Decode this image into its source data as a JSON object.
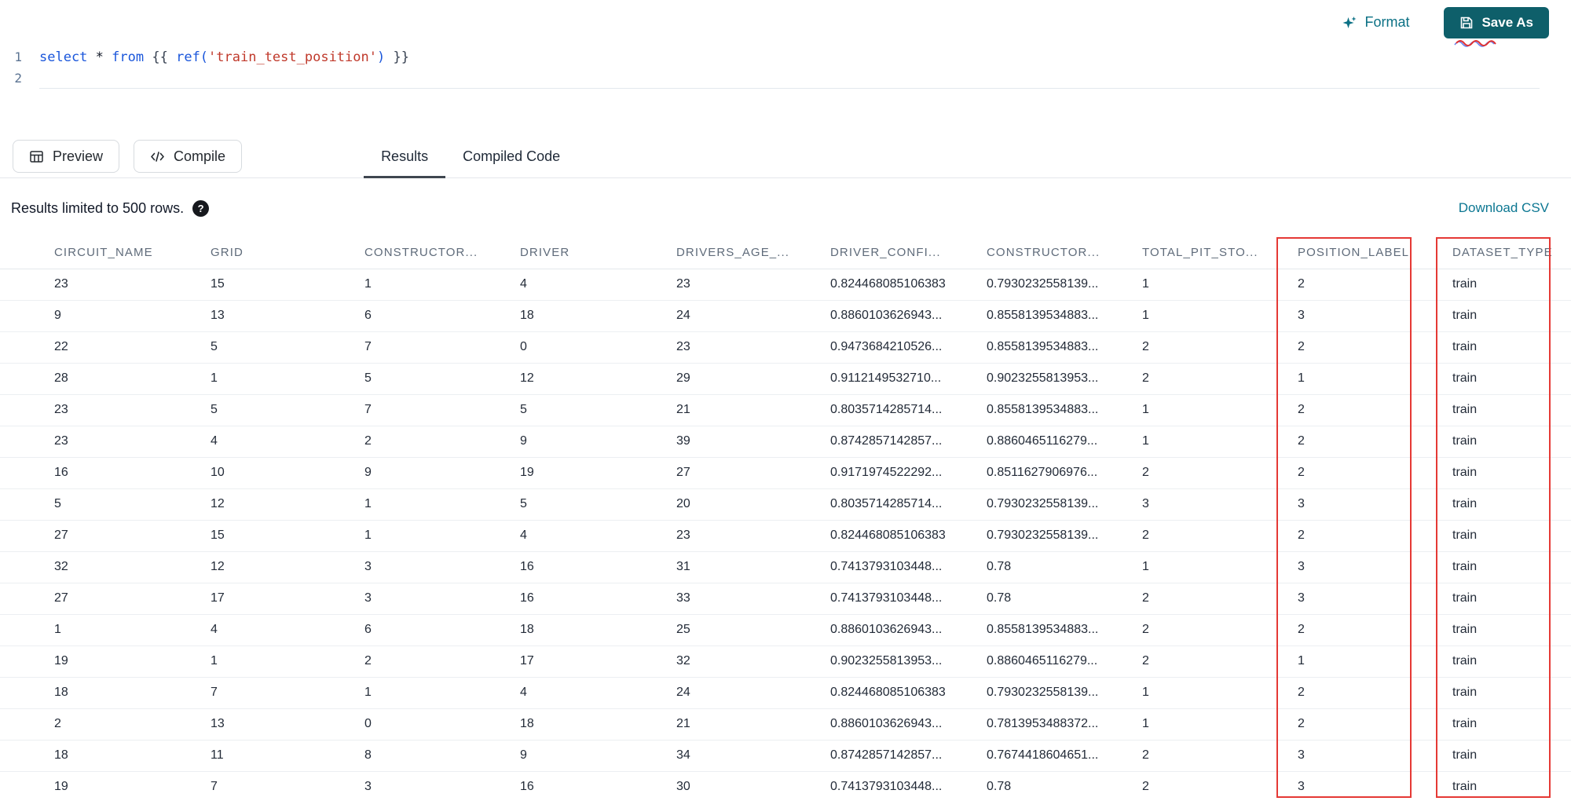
{
  "topbar": {
    "format_label": "Format",
    "save_as_label": "Save As"
  },
  "editor": {
    "line_numbers": [
      "1",
      "2"
    ],
    "code_tokens": [
      {
        "text": "select",
        "type": "kw"
      },
      {
        "text": " ",
        "type": "pl"
      },
      {
        "text": "*",
        "type": "op"
      },
      {
        "text": " ",
        "type": "pl"
      },
      {
        "text": "from",
        "type": "kw"
      },
      {
        "text": " ",
        "type": "pl"
      },
      {
        "text": "{{ ",
        "type": "jinja"
      },
      {
        "text": "ref(",
        "type": "fn"
      },
      {
        "text": "'train_test_position'",
        "type": "str"
      },
      {
        "text": ")",
        "type": "fn"
      },
      {
        "text": " }}",
        "type": "jinja"
      }
    ]
  },
  "toolbar": {
    "preview_label": "Preview",
    "compile_label": "Compile",
    "tabs": [
      {
        "label": "Results",
        "active": true
      },
      {
        "label": "Compiled Code",
        "active": false
      }
    ]
  },
  "results": {
    "limit_text": "Results limited to 500 rows.",
    "help_icon": "?",
    "download_label": "Download CSV"
  },
  "table": {
    "columns": [
      "CIRCUIT_NAME",
      "GRID",
      "CONSTRUCTOR...",
      "DRIVER",
      "DRIVERS_AGE_...",
      "DRIVER_CONFI...",
      "CONSTRUCTOR...",
      "TOTAL_PIT_STO...",
      "POSITION_LABEL",
      "DATASET_TYPE"
    ],
    "rows": [
      [
        "23",
        "15",
        "1",
        "4",
        "23",
        "0.824468085106383",
        "0.7930232558139...",
        "1",
        "2",
        "train"
      ],
      [
        "9",
        "13",
        "6",
        "18",
        "24",
        "0.8860103626943...",
        "0.8558139534883...",
        "1",
        "3",
        "train"
      ],
      [
        "22",
        "5",
        "7",
        "0",
        "23",
        "0.9473684210526...",
        "0.8558139534883...",
        "2",
        "2",
        "train"
      ],
      [
        "28",
        "1",
        "5",
        "12",
        "29",
        "0.9112149532710...",
        "0.9023255813953...",
        "2",
        "1",
        "train"
      ],
      [
        "23",
        "5",
        "7",
        "5",
        "21",
        "0.8035714285714...",
        "0.8558139534883...",
        "1",
        "2",
        "train"
      ],
      [
        "23",
        "4",
        "2",
        "9",
        "39",
        "0.8742857142857...",
        "0.8860465116279...",
        "1",
        "2",
        "train"
      ],
      [
        "16",
        "10",
        "9",
        "19",
        "27",
        "0.9171974522292...",
        "0.8511627906976...",
        "2",
        "2",
        "train"
      ],
      [
        "5",
        "12",
        "1",
        "5",
        "20",
        "0.8035714285714...",
        "0.7930232558139...",
        "3",
        "3",
        "train"
      ],
      [
        "27",
        "15",
        "1",
        "4",
        "23",
        "0.824468085106383",
        "0.7930232558139...",
        "2",
        "2",
        "train"
      ],
      [
        "32",
        "12",
        "3",
        "16",
        "31",
        "0.7413793103448...",
        "0.78",
        "1",
        "3",
        "train"
      ],
      [
        "27",
        "17",
        "3",
        "16",
        "33",
        "0.7413793103448...",
        "0.78",
        "2",
        "3",
        "train"
      ],
      [
        "1",
        "4",
        "6",
        "18",
        "25",
        "0.8860103626943...",
        "0.8558139534883...",
        "2",
        "2",
        "train"
      ],
      [
        "19",
        "1",
        "2",
        "17",
        "32",
        "0.9023255813953...",
        "0.8860465116279...",
        "2",
        "1",
        "train"
      ],
      [
        "18",
        "7",
        "1",
        "4",
        "24",
        "0.824468085106383",
        "0.7930232558139...",
        "1",
        "2",
        "train"
      ],
      [
        "2",
        "13",
        "0",
        "18",
        "21",
        "0.8860103626943...",
        "0.7813953488372...",
        "1",
        "2",
        "train"
      ],
      [
        "18",
        "11",
        "8",
        "9",
        "34",
        "0.8742857142857...",
        "0.7674418604651...",
        "2",
        "3",
        "train"
      ],
      [
        "19",
        "7",
        "3",
        "16",
        "30",
        "0.7413793103448...",
        "0.78",
        "2",
        "3",
        "train"
      ]
    ]
  },
  "colors": {
    "accent_teal": "#0c7792",
    "button_teal": "#0e5f6a",
    "highlight_red": "#e53935",
    "keyword_blue": "#1a56db",
    "string_red": "#c0392b"
  }
}
